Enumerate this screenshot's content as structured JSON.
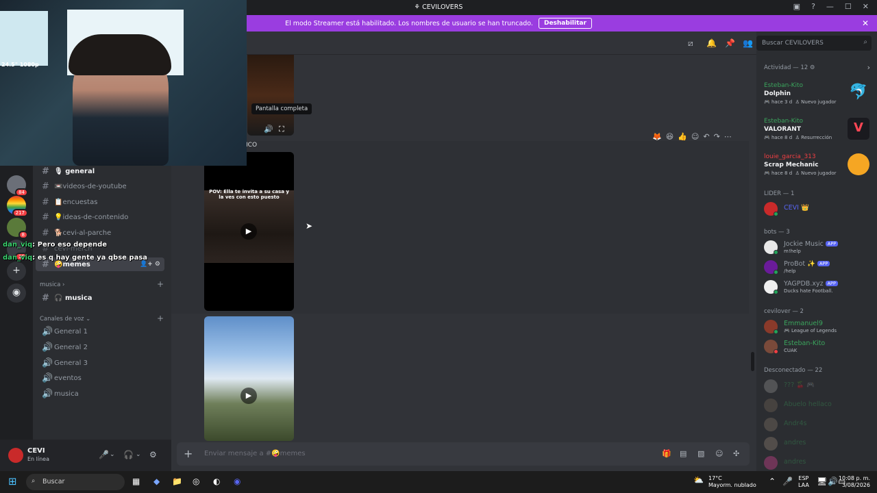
{
  "window": {
    "title": "CEVILOVERS"
  },
  "banner": {
    "text": "El modo Streamer está habilitado. Los nombres de usuario se han truncado.",
    "button": "Deshabilitar"
  },
  "guild_badges": [
    "84",
    "217",
    "8",
    "18"
  ],
  "channels": [
    {
      "name": "general",
      "emoji": "🎙"
    },
    {
      "name": "videos-de-youtube",
      "emoji": "📼"
    },
    {
      "name": "encuestas",
      "emoji": "📋"
    },
    {
      "name": "ideas-de-contenido",
      "emoji": "💡"
    },
    {
      "name": "cevi-al-parche",
      "emoji": "🐕"
    },
    {
      "name": "cevi-merch",
      "emoji": ""
    },
    {
      "name": "memes",
      "emoji": "🤪"
    }
  ],
  "categories": {
    "musica": "musica",
    "voice": "Canales de voz"
  },
  "music_channel": "musica",
  "voice_channels": [
    "General 1",
    "General 2",
    "General 3",
    "eventos",
    "musica"
  ],
  "user": {
    "name": "CEVI",
    "status": "En línea"
  },
  "chat": {
    "tooltip": "Pantalla completa",
    "partial_label": "ICO",
    "video_caption": "POV: Ella te invita a su casa y la ves con esto puesto",
    "input_placeholder": "Enviar mensaje a #🤪memes"
  },
  "search": {
    "placeholder": "Buscar CEVILOVERS"
  },
  "activity": {
    "header": "Actividad — 12",
    "cards": [
      {
        "user": "Esteban-Kito",
        "game": "Dolphin",
        "time": "hace 3 d",
        "tag": "Nuevo jugador"
      },
      {
        "user": "Esteban-Kito",
        "game": "VALORANT",
        "time": "hace 8 d",
        "tag": "Resurrección"
      },
      {
        "user": "louie_garcia_313",
        "game": "Scrap Mechanic",
        "time": "hace 8 d",
        "tag": "Nuevo jugador"
      }
    ]
  },
  "groups": {
    "lider": "LIDER — 1",
    "bots": "bots — 3",
    "cevilover": "cevilover — 2",
    "offline": "Desconectado — 22"
  },
  "members": {
    "lider": [
      {
        "name": "CEVI",
        "sub": ""
      }
    ],
    "bots": [
      {
        "name": "Jockie Music",
        "sub": "m!help",
        "app": "APP"
      },
      {
        "name": "ProBot",
        "sub": "/help",
        "app": "APP"
      },
      {
        "name": "YAGPDB.xyz",
        "sub": "Ducks hate Football.",
        "app": "APP"
      }
    ],
    "cevilover": [
      {
        "name": "Emmanuel9",
        "sub": "League of Legends"
      },
      {
        "name": "Esteban-Kito",
        "sub": "CUAK"
      }
    ],
    "offline": [
      "???",
      "Abuelo hellaco",
      "Andr4s",
      "andres",
      "andres"
    ]
  },
  "overlay_chat": [
    {
      "user": "dan_viq",
      "text": ": Pero eso depende"
    },
    {
      "user": "dan_viq",
      "text": ": es q hay gente ya qbse pasa"
    }
  ],
  "webcam": {
    "spec": "24.5\" 1080p"
  },
  "taskbar": {
    "search": "Buscar",
    "weather_temp": "17°C",
    "weather_desc": "Mayorm. nublado",
    "lang1": "ESP",
    "lang2": "LAA",
    "time": "10:08 p. m.",
    "date": "3/08/2026"
  }
}
